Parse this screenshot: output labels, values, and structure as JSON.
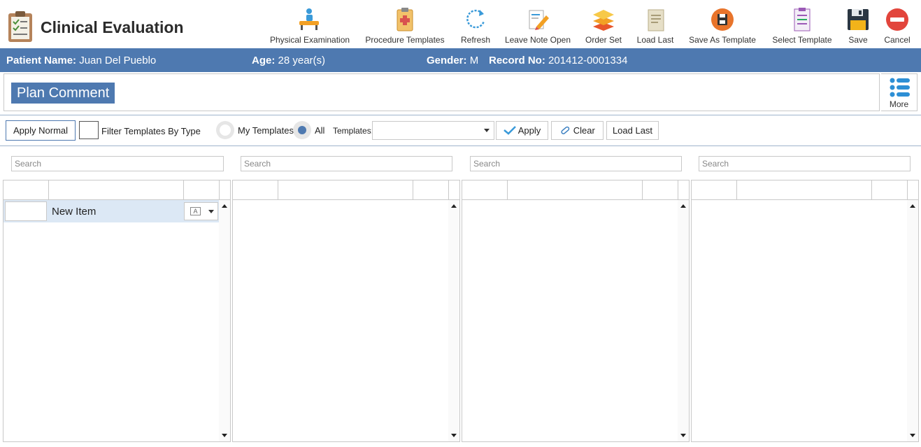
{
  "app": {
    "title": "Clinical Evaluation"
  },
  "toolbar": {
    "items": [
      {
        "label": "Physical Examination",
        "icon": "physical-exam-icon"
      },
      {
        "label": "Procedure Templates",
        "icon": "clipboard-medical-icon"
      },
      {
        "label": "Refresh",
        "icon": "refresh-icon"
      },
      {
        "label": "Leave Note Open",
        "icon": "edit-note-icon"
      },
      {
        "label": "Order Set",
        "icon": "layers-icon"
      },
      {
        "label": "Load Last",
        "icon": "document-icon"
      },
      {
        "label": "Save As Template",
        "icon": "save-circle-icon"
      },
      {
        "label": "Select Template",
        "icon": "template-list-icon"
      },
      {
        "label": "Save",
        "icon": "floppy-disk-icon"
      },
      {
        "label": "Cancel",
        "icon": "cancel-icon"
      }
    ]
  },
  "patient": {
    "name_label": "Patient Name:",
    "name": "Juan Del Pueblo",
    "age_label": "Age:",
    "age": "28 year(s)",
    "gender_label": "Gender:",
    "gender": "M",
    "record_label": "Record No:",
    "record": "201412-0001334"
  },
  "section": {
    "title": "Plan Comment",
    "more_label": "More"
  },
  "filter": {
    "apply_normal": "Apply Normal",
    "filter_by_type": "Filter Templates By Type",
    "my_templates": "My Templates",
    "all": "All",
    "templates_label": "Templates:",
    "templates_value": "",
    "apply": "Apply",
    "clear": "Clear",
    "load_last": "Load Last"
  },
  "columns": {
    "search_placeholder": "Search",
    "first_row": {
      "text": "New Item"
    }
  },
  "colors": {
    "accent": "#4e79b0",
    "border": "#c9c9c9",
    "selected_row": "#dce8f5"
  }
}
